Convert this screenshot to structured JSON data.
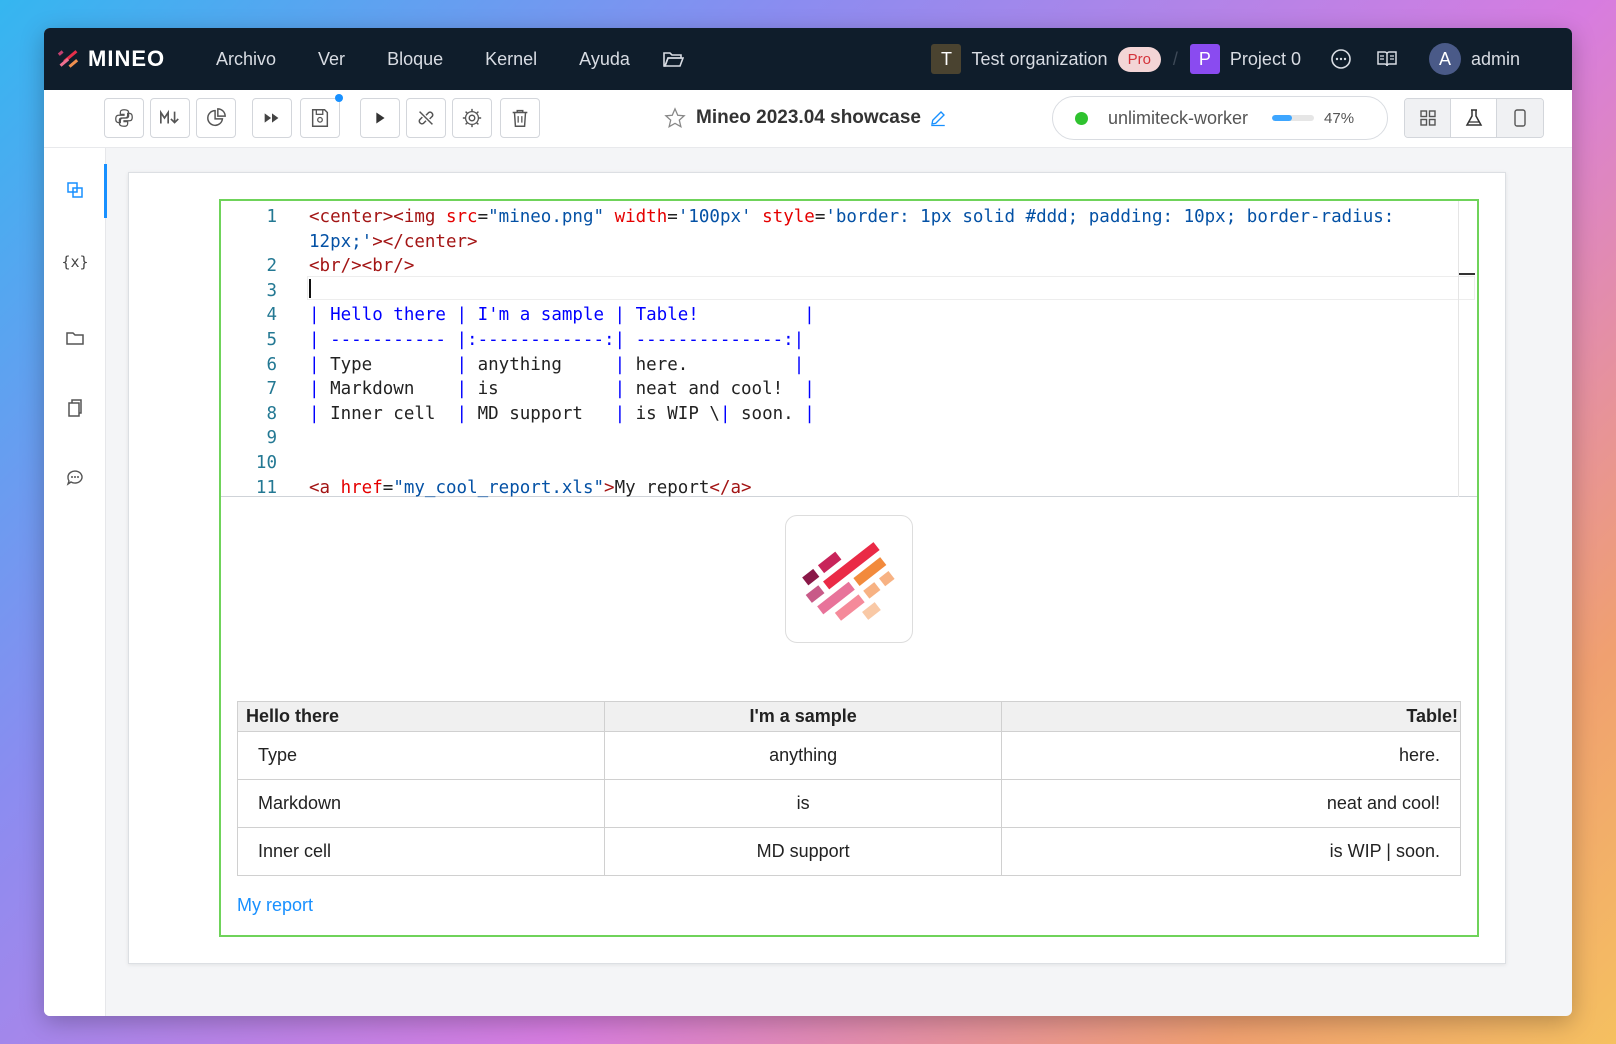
{
  "topbar": {
    "logo_text": "MINEO",
    "menu": [
      "Archivo",
      "Ver",
      "Bloque",
      "Kernel",
      "Ayuda"
    ],
    "org": {
      "initial": "T",
      "name": "Test organization",
      "badge": "Pro"
    },
    "separator": "/",
    "project": {
      "initial": "P",
      "name": "Project 0"
    },
    "user": {
      "initial": "A",
      "name": "admin"
    }
  },
  "toolbar": {
    "doc_title": "Mineo 2023.04 showcase",
    "worker": {
      "name": "unlimiteck-worker",
      "percent_label": "47%",
      "usage_fraction": 0.47,
      "status_color": "#2fc22f"
    }
  },
  "sidebar": {
    "variables_label": "{x}"
  },
  "editor": {
    "line_numbers": [
      "1",
      "",
      "2",
      "3",
      "4",
      "5",
      "6",
      "7",
      "8",
      "9",
      "10",
      "11"
    ],
    "lines": [
      [
        {
          "t": "tag",
          "s": "<center><img "
        },
        {
          "t": "attr",
          "s": "src"
        },
        {
          "t": "plain",
          "s": "="
        },
        {
          "t": "val",
          "s": "\"mineo.png\""
        },
        {
          "t": "plain",
          "s": " "
        },
        {
          "t": "attr",
          "s": "width"
        },
        {
          "t": "plain",
          "s": "="
        },
        {
          "t": "val",
          "s": "'100px'"
        },
        {
          "t": "plain",
          "s": " "
        },
        {
          "t": "attr",
          "s": "style"
        },
        {
          "t": "plain",
          "s": "="
        },
        {
          "t": "val",
          "s": "'border: 1px solid #ddd; padding: 10px; border-radius:"
        }
      ],
      [
        {
          "t": "val",
          "s": "12px;'"
        },
        {
          "t": "tag",
          "s": "></center>"
        }
      ],
      [
        {
          "t": "tag",
          "s": "<br/><br/>"
        }
      ],
      [],
      [
        {
          "t": "md",
          "s": "| Hello there | I'm a sample | Table!          |"
        }
      ],
      [
        {
          "t": "md",
          "s": "| ----------- |:------------:| --------------:|"
        }
      ],
      [
        {
          "t": "md",
          "s": "| "
        },
        {
          "t": "plain",
          "s": "Type        "
        },
        {
          "t": "md",
          "s": "| "
        },
        {
          "t": "plain",
          "s": "anything     "
        },
        {
          "t": "md",
          "s": "| "
        },
        {
          "t": "plain",
          "s": "here.          "
        },
        {
          "t": "md",
          "s": "|"
        }
      ],
      [
        {
          "t": "md",
          "s": "| "
        },
        {
          "t": "plain",
          "s": "Markdown    "
        },
        {
          "t": "md",
          "s": "| "
        },
        {
          "t": "plain",
          "s": "is           "
        },
        {
          "t": "md",
          "s": "| "
        },
        {
          "t": "plain",
          "s": "neat and cool!  "
        },
        {
          "t": "md",
          "s": "|"
        }
      ],
      [
        {
          "t": "md",
          "s": "| "
        },
        {
          "t": "plain",
          "s": "Inner cell  "
        },
        {
          "t": "md",
          "s": "| "
        },
        {
          "t": "plain",
          "s": "MD support   "
        },
        {
          "t": "md",
          "s": "| "
        },
        {
          "t": "plain",
          "s": "is WIP \\"
        },
        {
          "t": "md",
          "s": "|"
        },
        {
          "t": "plain",
          "s": " soon. "
        },
        {
          "t": "md",
          "s": "|"
        }
      ],
      [],
      [],
      [
        {
          "t": "tag",
          "s": "<a "
        },
        {
          "t": "attr",
          "s": "href"
        },
        {
          "t": "plain",
          "s": "="
        },
        {
          "t": "val",
          "s": "\"my_cool_report.xls\""
        },
        {
          "t": "tag",
          "s": ">"
        },
        {
          "t": "plain",
          "s": "My report"
        },
        {
          "t": "tag",
          "s": "</a>"
        }
      ]
    ]
  },
  "output": {
    "table": {
      "headers": [
        "Hello there",
        "I'm a sample",
        "Table!"
      ],
      "rows": [
        [
          "Type",
          "anything",
          "here."
        ],
        [
          "Markdown",
          "is",
          "neat and cool!"
        ],
        [
          "Inner cell",
          "MD support",
          "is WIP | soon."
        ]
      ]
    },
    "link_text": "My report"
  }
}
